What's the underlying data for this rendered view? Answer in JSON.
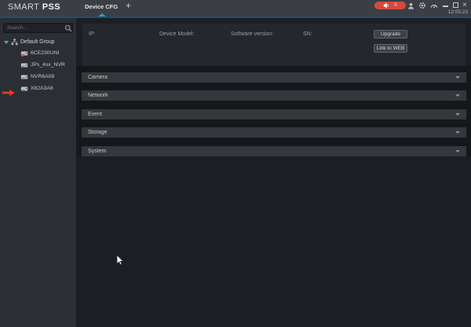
{
  "brand": {
    "name_light": "SMART",
    "name_bold": "PSS"
  },
  "header": {
    "active_tab": "Device CFG",
    "add_tab_glyph": "+",
    "alarm_badge_count": "0",
    "close_glyph": "×",
    "time": "12:05:23"
  },
  "icons": {
    "alarm_sound": "speaker",
    "user": "person",
    "settings": "gear",
    "monitor": "gauge",
    "minimize": "minus-line",
    "maximize": "square-outline",
    "search": "magnifier",
    "group": "org-tree",
    "device": "nvr-box",
    "tree_expand": "triangle-down-blue",
    "section_expand": "triangle-down-grey",
    "annotation": "red-arrow-right",
    "pointer": "mouse-cursor"
  },
  "sidebar": {
    "search_placeholder": "Search...",
    "group_label": "Default Group",
    "devices": [
      {
        "name": "6CE230UNI"
      },
      {
        "name": "JPs_4xx_NVR"
      },
      {
        "name": "NVR6A08"
      },
      {
        "name": "X82A3A6"
      }
    ]
  },
  "device_info": {
    "labels": [
      "IP:",
      "Device Model:",
      "Software version:",
      "SN:"
    ],
    "upgrade_label": "Upgrade",
    "link_web_label": "Link to WEB"
  },
  "sections": [
    {
      "label": "Camera"
    },
    {
      "label": "Network"
    },
    {
      "label": "Event"
    },
    {
      "label": "Storage"
    },
    {
      "label": "System"
    }
  ],
  "colors": {
    "topbar": "#3b3f44",
    "accent_line": "#1a5078",
    "tab_caret": "#3f93c4",
    "alarm_badge": "#d5493d",
    "sidebar_bg": "#2b2f33",
    "main_bg": "#1b1e22",
    "panel_bg": "#24272b",
    "section_bg": "#34383d",
    "tree_caret_blue": "#4da3d6",
    "annotation_red": "#e6392a"
  }
}
